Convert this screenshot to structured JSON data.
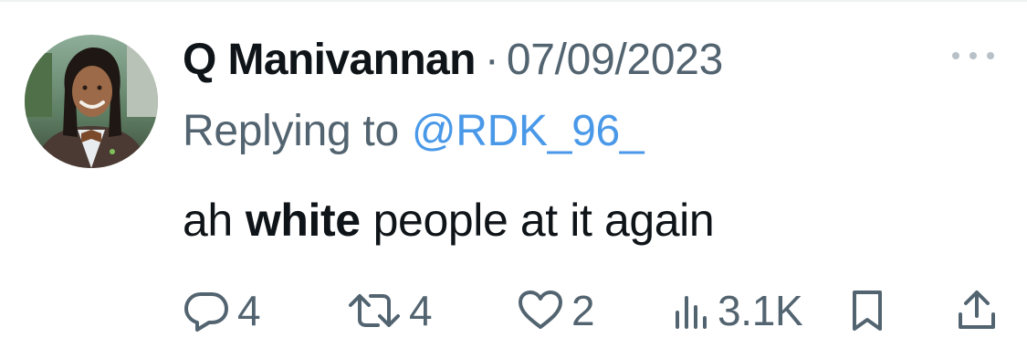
{
  "tweet": {
    "author_name": "Q Manivannan",
    "separator": "·",
    "timestamp": "07/09/2023",
    "replying_label": "Replying to",
    "reply_handle": "@RDK_96_",
    "text_before": "ah",
    "text_bold": "white",
    "text_after": "people at it again"
  },
  "metrics": {
    "replies": "4",
    "retweets": "4",
    "likes": "2",
    "views": "3.1K"
  },
  "icons": {
    "more": "more-icon",
    "reply": "reply-icon",
    "retweet": "retweet-icon",
    "like": "heart-icon",
    "views": "views-icon",
    "bookmark": "bookmark-icon",
    "share": "share-icon"
  },
  "colors": {
    "text": "#0f1419",
    "secondary": "#536471",
    "link": "#4a99e9"
  }
}
